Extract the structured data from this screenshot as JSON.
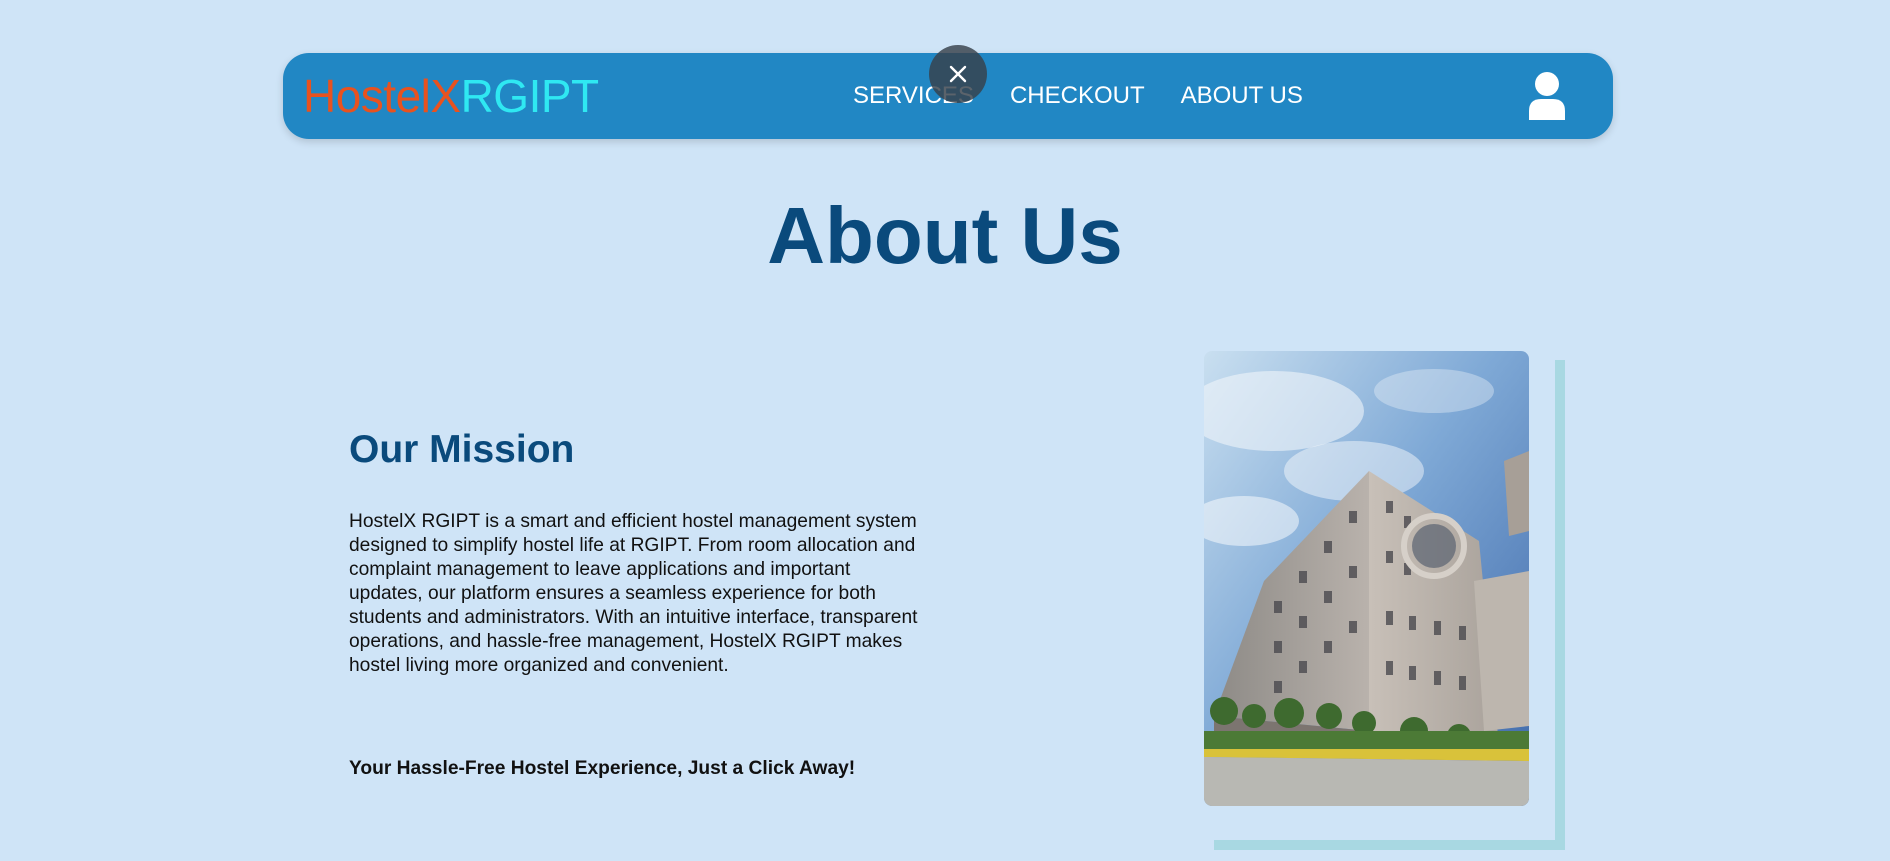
{
  "navbar": {
    "brand_part1": "HostelX",
    "brand_part2": "RGIPT",
    "links": [
      {
        "label": "SERVICES"
      },
      {
        "label": "CHECKOUT"
      },
      {
        "label": "ABOUT US"
      }
    ],
    "user_icon": "user-icon",
    "close_icon": "close-icon"
  },
  "page": {
    "title": "About Us"
  },
  "mission": {
    "heading": "Our Mission",
    "body": "HostelX RGIPT is a smart and efficient hostel management system designed to simplify hostel life at RGIPT. From room allocation and complaint management to leave applications and important updates, our platform ensures a seamless experience for both students and administrators. With an intuitive interface, transparent operations, and hassle-free management, HostelX RGIPT makes hostel living more organized and convenient.",
    "tagline": "Your Hassle-Free Hostel Experience, Just a Click Away!"
  },
  "colors": {
    "background": "#cfe4f7",
    "navbar": "#2187c4",
    "brand_part1": "#e8521f",
    "brand_part2": "#2fe8f2",
    "heading": "#0a4a7c",
    "photo_frame": "#a8d8e2"
  }
}
